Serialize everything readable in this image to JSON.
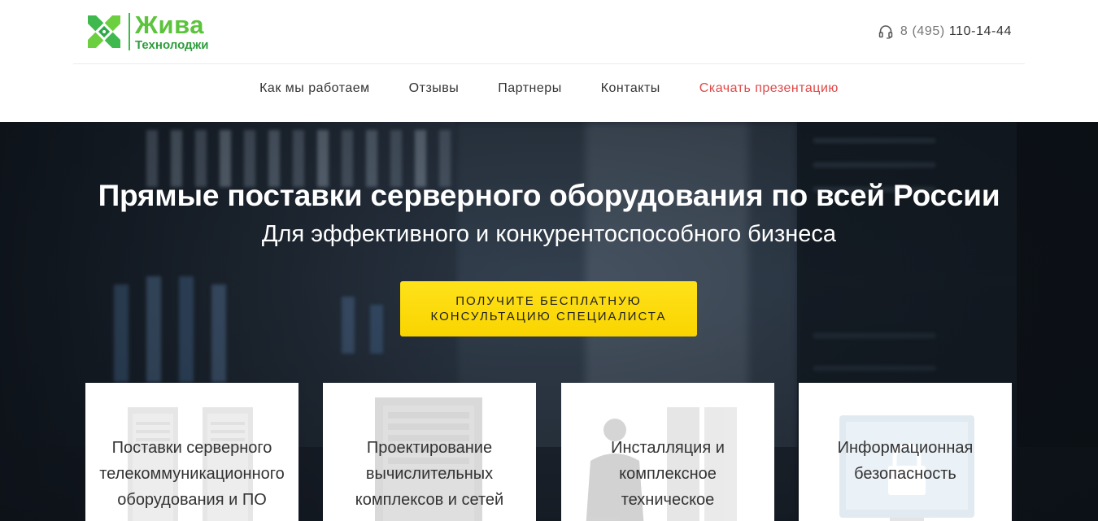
{
  "header": {
    "logo": {
      "line1": "Жива",
      "line2": "Технолоджи"
    },
    "phone": {
      "prefix": "8 (495)",
      "number": "110-14-44",
      "icon": "headset-icon"
    }
  },
  "nav": {
    "items": [
      {
        "label": "Как мы работаем"
      },
      {
        "label": "Отзывы"
      },
      {
        "label": "Партнеры"
      },
      {
        "label": "Контакты"
      },
      {
        "label": "Скачать презентацию"
      }
    ]
  },
  "hero": {
    "title": "Прямые поставки серверного оборудования по всей России",
    "subtitle": "Для эффективного и конкурентоспособного бизнеса",
    "cta": {
      "line1": "ПОЛУЧИТЕ БЕСПЛАТНУЮ",
      "line2": "КОНСУЛЬТАЦИЮ СПЕЦИАЛИСТА"
    }
  },
  "services": [
    {
      "lines": [
        "Поставки серверного",
        "телекоммуникационного",
        "оборудования и ПО"
      ],
      "icon": "server-racks-icon"
    },
    {
      "lines": [
        "Проектирование",
        "вычислительных",
        "комплексов и сетей"
      ],
      "icon": "server-cabinet-icon"
    },
    {
      "lines": [
        "Инсталляция и",
        "комплексное",
        "техническое"
      ],
      "icon": "technician-icon"
    },
    {
      "lines": [
        "Информационная",
        "безопасность"
      ],
      "icon": "monitor-lock-icon"
    }
  ],
  "colors": {
    "brand_green": "#5cc33c",
    "brand_green_dark": "#2e9e3e",
    "accent_red": "#e04848",
    "cta_yellow": "#ffe21a"
  }
}
